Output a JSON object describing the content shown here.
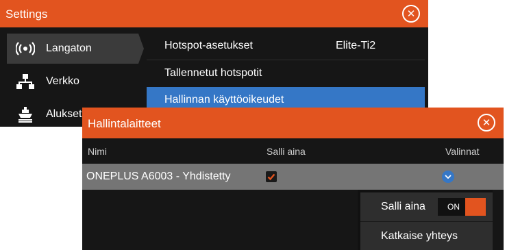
{
  "settings": {
    "title": "Settings",
    "nav": [
      {
        "label": "Langaton",
        "icon": "wireless-icon",
        "active": true
      },
      {
        "label": "Verkko",
        "icon": "network-icon",
        "active": false
      },
      {
        "label": "Alukset",
        "icon": "vessels-icon",
        "active": false
      }
    ],
    "submenu": [
      {
        "label": "Hotspot-asetukset",
        "value": "Elite-Ti2"
      },
      {
        "label": "Tallennetut hotspotit"
      },
      {
        "label": "Hallinnan käyttöoikeudet",
        "highlighted": true
      }
    ]
  },
  "devices_dialog": {
    "title": "Hallintalaitteet",
    "columns": {
      "name": "Nimi",
      "allow_always": "Salli aina",
      "options": "Valinnat"
    },
    "rows": [
      {
        "name": "ONEPLUS A6003 - Yhdistetty",
        "allow_always": true
      }
    ]
  },
  "popup": {
    "allow_always_label": "Salli aina",
    "toggle_state": "ON",
    "disconnect_label": "Katkaise yhteys"
  },
  "colors": {
    "accent": "#e2541f",
    "highlight": "#3577c6",
    "background": "#161616",
    "row": "#757575"
  }
}
